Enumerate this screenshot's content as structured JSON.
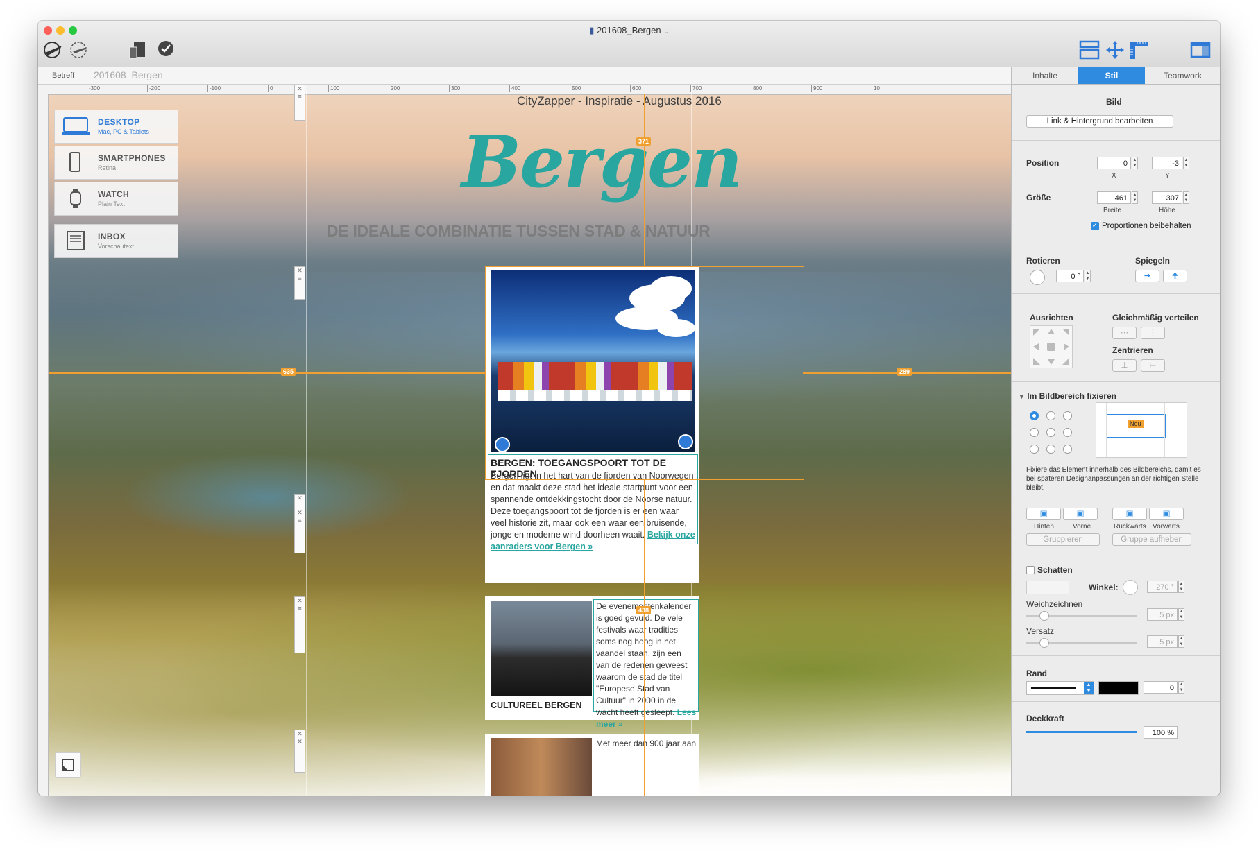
{
  "window": {
    "title": "201608_Bergen",
    "traffic_lights": [
      "#fc5f57",
      "#fdbc2e",
      "#28c840"
    ],
    "toolbar_left_icons": [
      "airplane-departure-icon",
      "airplane-icon",
      "devices-icon",
      "checkmark-icon"
    ],
    "toolbar_right_icons": [
      "layout-icon",
      "move-arrows-icon",
      "ruler-icon",
      "sidebar-icon"
    ]
  },
  "subject": {
    "label": "Betreff",
    "value": "201608_Bergen"
  },
  "ruler": {
    "ticks": [
      "-300",
      "-200",
      "-100",
      "0",
      "100",
      "200",
      "300",
      "400",
      "500",
      "600",
      "700",
      "800",
      "900",
      "10"
    ]
  },
  "devices": [
    {
      "title": "DESKTOP",
      "subtitle": "Mac, PC & Tablets",
      "active": true
    },
    {
      "title": "SMARTPHONES",
      "subtitle": "Retina",
      "active": false
    },
    {
      "title": "WATCH",
      "subtitle": "Plain Text",
      "active": false
    },
    {
      "title": "INBOX",
      "subtitle": "Vorschautext",
      "active": false
    }
  ],
  "newsletter": {
    "tagline": "CityZapper - Inspiratie - Augustus 2016",
    "title": "Bergen",
    "subtitle": "DE IDEALE COMBINATIE TUSSEN STAD & NATUUR",
    "article1": {
      "title": "BERGEN: TOEGANGSPOORT TOT DE FJORDEN",
      "body": "Bergen ligt in het hart van de fjorden van Noorwegen en dat maakt deze stad het ideale startpunt voor een spannende ontdekkingstocht door de Noorse natuur. Deze toegangspoort tot de fjorden is er een waar veel historie zit, maar ook een waar een bruisende, jonge en moderne wind doorheen waait.",
      "link": "Bekijk onze aanraders voor Bergen »"
    },
    "article2": {
      "title": "CULTUREEL BERGEN",
      "body": "De evenementenkalender is goed gevuld. De vele festivals waar tradities soms nog hoog in het vaandel staan, zijn een van de redenen geweest waarom de stad de titel \"Europese Stad van Cultuur\" in 2000 in de wacht heeft gesleept.",
      "link": "Lees meer »"
    },
    "article3": {
      "body": "Met meer dan 900 jaar aan"
    }
  },
  "measurements": {
    "top": "371",
    "left": "635",
    "right": "289",
    "bottom": "438"
  },
  "inspector": {
    "tabs": [
      "Inhalte",
      "Stil",
      "Teamwork"
    ],
    "active_tab": "Stil",
    "section_image": "Bild",
    "link_button": "Link & Hintergrund bearbeiten",
    "position_label": "Position",
    "position_x": "0",
    "position_y": "-3",
    "x_label": "X",
    "y_label": "Y",
    "size_label": "Größe",
    "width": "461",
    "height": "307",
    "width_label": "Breite",
    "height_label": "Höhe",
    "keep_proportions": "Proportionen beibehalten",
    "rotate_label": "Rotieren",
    "rotate_value": "0 °",
    "mirror_label": "Spiegeln",
    "align_label": "Ausrichten",
    "distribute_label": "Gleichmäßig verteilen",
    "center_label": "Zentrieren",
    "pin_label": "Im Bildbereich fixieren",
    "pin_badge": "Neu",
    "pin_help": "Fixiere das Element innerhalb des Bildbereichs, damit es bei späteren Designanpassungen an der richtigen Stelle bleibt.",
    "order_back": "Hinten",
    "order_front": "Vorne",
    "order_backward": "Rückwärts",
    "order_forward": "Vorwärts",
    "group": "Gruppieren",
    "ungroup": "Gruppe aufheben",
    "shadow_label": "Schatten",
    "angle_label": "Winkel:",
    "angle_value": "270 °",
    "blur_label": "Weichzeichnen",
    "blur_value": "5 px",
    "offset_label": "Versatz",
    "offset_value": "5 px",
    "border_label": "Rand",
    "border_value": "0",
    "opacity_label": "Deckkraft",
    "opacity_value": "100 %",
    "accent_color": "#2e8bdf"
  }
}
